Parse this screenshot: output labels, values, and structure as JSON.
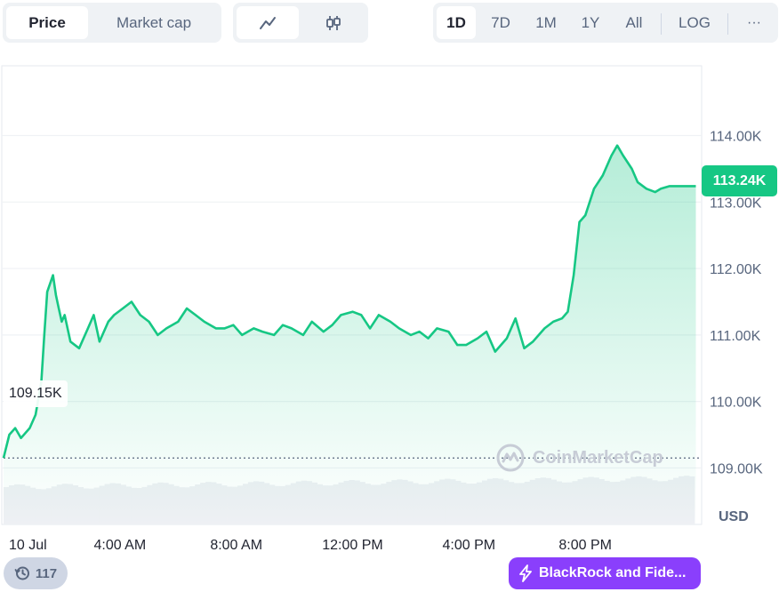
{
  "toolbar": {
    "metric_tabs": [
      "Price",
      "Market cap"
    ],
    "active_metric": "Price",
    "chart_type_icons": [
      "line-chart-icon",
      "candlestick-chart-icon"
    ],
    "range_tabs": [
      "1D",
      "7D",
      "1M",
      "1Y",
      "All"
    ],
    "active_range": "1D",
    "log_label": "LOG",
    "more_label": "···"
  },
  "current_price_label": "113.24K",
  "start_price_label": "109.15K",
  "watermark_text": "CoinMarketCap",
  "currency_label": "USD",
  "history_count": "117",
  "news_badge_text": "BlackRock and Fide...",
  "colors": {
    "line": "#16c784",
    "area_top": "#16c784",
    "badge_current": "#16c784",
    "news_badge": "#8a3ffc",
    "grid": "#eff2f5",
    "axis_text": "#58667e"
  },
  "chart_data": {
    "type": "area",
    "title": "",
    "xlabel": "",
    "ylabel": "USD",
    "x_ticks": [
      "10 Jul",
      "4:00 AM",
      "8:00 AM",
      "12:00 PM",
      "4:00 PM",
      "8:00 PM"
    ],
    "x_tick_hours": [
      0,
      4,
      8,
      12,
      16,
      20
    ],
    "y_ticks": [
      109000,
      110000,
      111000,
      112000,
      113000,
      114000
    ],
    "y_tick_labels": [
      "109.00K",
      "110.00K",
      "111.00K",
      "112.00K",
      "113.00K",
      "114.00K"
    ],
    "xlim_hours": [
      0,
      24
    ],
    "ylim": [
      108150,
      115050
    ],
    "open_price": 109150,
    "current_price": 113240,
    "grid": true,
    "series": [
      {
        "x_hours": [
          0,
          0.2,
          0.4,
          0.6,
          0.9,
          1.1,
          1.3,
          1.4,
          1.5,
          1.7,
          1.8,
          1.9,
          2.0,
          2.1,
          2.3,
          2.6,
          2.9,
          3.1,
          3.3,
          3.6,
          3.8,
          4.1,
          4.4,
          4.7,
          5.0,
          5.3,
          5.6,
          6.0,
          6.3,
          6.6,
          6.9,
          7.3,
          7.6,
          7.9,
          8.2,
          8.6,
          8.9,
          9.3,
          9.6,
          9.9,
          10.3,
          10.6,
          11.0,
          11.3,
          11.6,
          12.0,
          12.3,
          12.6,
          12.9,
          13.3,
          13.6,
          14.0,
          14.3,
          14.6,
          14.9,
          15.3,
          15.6,
          15.9,
          16.3,
          16.6,
          16.9,
          17.3,
          17.6,
          17.9,
          18.2,
          18.6,
          18.9,
          19.2,
          19.4,
          19.6,
          19.8,
          20.0,
          20.3,
          20.6,
          20.9,
          21.1,
          21.3,
          21.6,
          21.8,
          22.1,
          22.4,
          22.6,
          22.9,
          23.1,
          23.3,
          23.6,
          23.8
        ],
        "values": [
          109150,
          109500,
          109600,
          109450,
          109600,
          109800,
          110300,
          111000,
          111650,
          111900,
          111600,
          111400,
          111200,
          111300,
          110900,
          110800,
          111100,
          111300,
          110900,
          111200,
          111300,
          111400,
          111500,
          111300,
          111200,
          111000,
          111100,
          111200,
          111400,
          111300,
          111200,
          111100,
          111100,
          111150,
          111000,
          111100,
          111050,
          111000,
          111150,
          111100,
          111000,
          111200,
          111050,
          111150,
          111300,
          111350,
          111300,
          111100,
          111300,
          111200,
          111100,
          111000,
          111050,
          110950,
          111100,
          111050,
          110850,
          110850,
          110950,
          111050,
          110750,
          110950,
          111250,
          110800,
          110900,
          111100,
          111200,
          111250,
          111350,
          111900,
          112700,
          112800,
          113200,
          113400,
          113700,
          113850,
          113700,
          113500,
          113300,
          113200,
          113150,
          113200,
          113240,
          113240,
          113240,
          113240,
          113240
        ]
      }
    ],
    "volume_band": true
  }
}
